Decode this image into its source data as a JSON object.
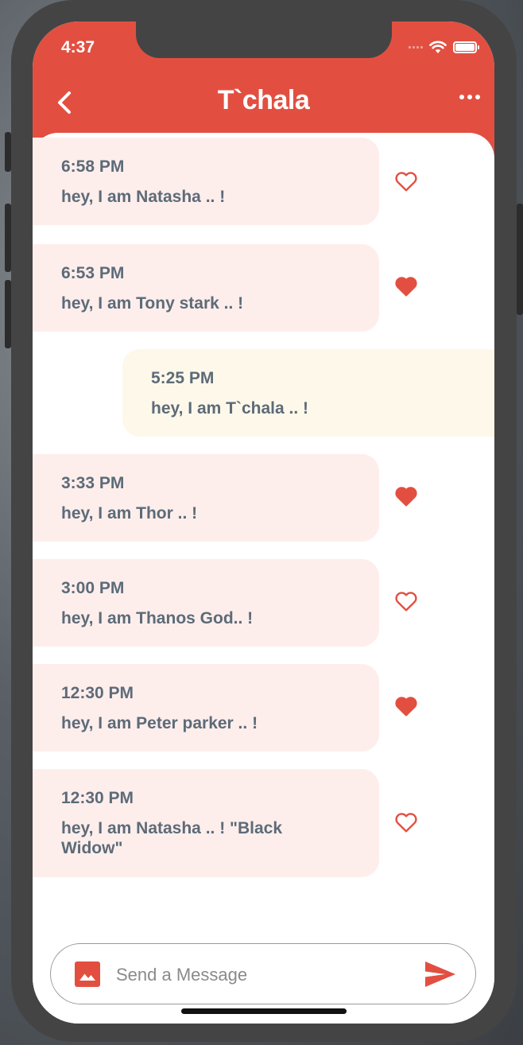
{
  "status_bar": {
    "time": "4:37"
  },
  "header": {
    "title": "T`chala"
  },
  "colors": {
    "accent": "#e24f41",
    "incoming_bg": "#fdeeec",
    "outgoing_bg": "#fef8ea",
    "text": "#5d6b78"
  },
  "messages": [
    {
      "time": "6:58 PM",
      "text": "hey, I am Natasha .. !",
      "direction": "incoming",
      "liked": false
    },
    {
      "time": "6:53 PM",
      "text": "hey, I am Tony stark .. !",
      "direction": "incoming",
      "liked": true
    },
    {
      "time": "5:25 PM",
      "text": "hey, I am T`chala .. !",
      "direction": "outgoing",
      "liked": null
    },
    {
      "time": "3:33 PM",
      "text": "hey, I am Thor .. !",
      "direction": "incoming",
      "liked": true
    },
    {
      "time": "3:00 PM",
      "text": "hey, I am Thanos God.. !",
      "direction": "incoming",
      "liked": false
    },
    {
      "time": "12:30 PM",
      "text": "hey, I am Peter parker .. !",
      "direction": "incoming",
      "liked": true
    },
    {
      "time": "12:30 PM",
      "text": "hey, I am Natasha .. !  \"Black Widow\"",
      "direction": "incoming",
      "liked": false
    }
  ],
  "composer": {
    "placeholder": "Send a Message"
  },
  "icons": {
    "back": "chevron-left-icon",
    "more": "more-horizontal-icon",
    "heart": "heart-icon",
    "image": "image-icon",
    "send": "send-icon"
  }
}
